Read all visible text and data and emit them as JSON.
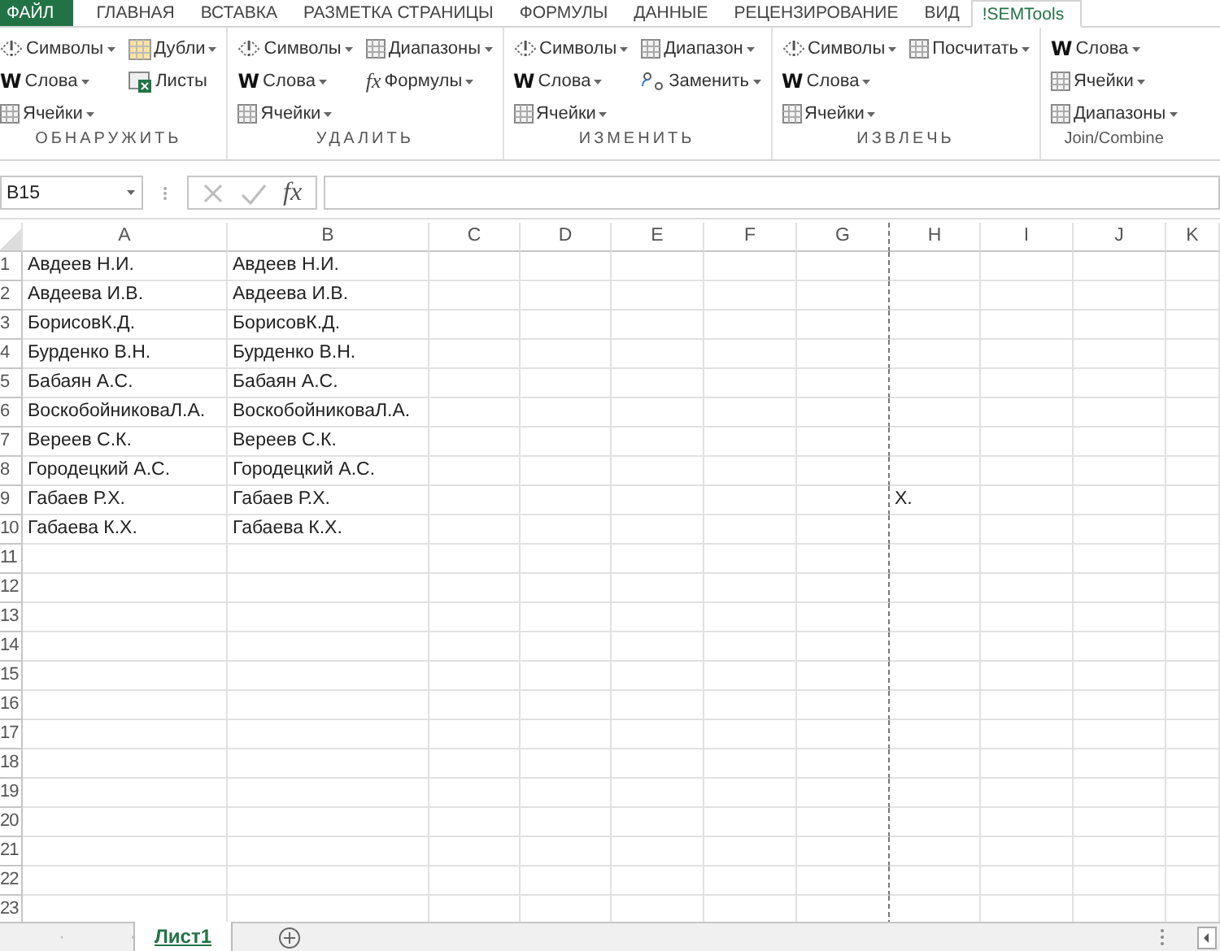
{
  "tabs": [
    {
      "label": "ФАЙЛ",
      "kind": "file",
      "selected": false
    },
    {
      "label": "ГЛАВНАЯ",
      "kind": "tab",
      "selected": false
    },
    {
      "label": "ВСТАВКА",
      "kind": "tab",
      "selected": false
    },
    {
      "label": "РАЗМЕТКА СТРАНИЦЫ",
      "kind": "tab",
      "selected": false
    },
    {
      "label": "ФОРМУЛЫ",
      "kind": "tab",
      "selected": false
    },
    {
      "label": "ДАННЫЕ",
      "kind": "tab",
      "selected": false
    },
    {
      "label": "РЕЦЕНЗИРОВАНИЕ",
      "kind": "tab",
      "selected": false
    },
    {
      "label": "ВИД",
      "kind": "tab",
      "selected": false
    },
    {
      "label": "!SEMTools",
      "kind": "tab",
      "selected": true
    }
  ],
  "ribbon": {
    "groups": [
      {
        "label": "ОБНАРУЖИТЬ",
        "spaced": true,
        "columns": [
          [
            {
              "kind": "symbols",
              "label": "Символы",
              "dropdown": true
            },
            {
              "kind": "words",
              "glyph": "W",
              "label": "Слова",
              "dropdown": true
            },
            {
              "kind": "grid",
              "label": "Ячейки",
              "dropdown": true
            }
          ],
          [
            {
              "kind": "dupes",
              "label": "Дубли",
              "dropdown": true
            },
            {
              "kind": "sheets",
              "label": "Листы",
              "dropdown": false
            }
          ]
        ]
      },
      {
        "label": "УДАЛИТЬ",
        "spaced": true,
        "columns": [
          [
            {
              "kind": "symbols",
              "label": "Символы",
              "dropdown": true
            },
            {
              "kind": "words",
              "glyph": "W",
              "label": "Слова",
              "dropdown": true
            },
            {
              "kind": "grid",
              "label": "Ячейки",
              "dropdown": true
            }
          ],
          [
            {
              "kind": "grid",
              "label": "Диапазоны",
              "dropdown": true
            },
            {
              "kind": "fx",
              "glyph": "fx",
              "label": "Формулы",
              "dropdown": true
            }
          ]
        ]
      },
      {
        "label": "ИЗМЕНИТЬ",
        "spaced": true,
        "columns": [
          [
            {
              "kind": "symbols",
              "label": "Символы",
              "dropdown": true
            },
            {
              "kind": "words",
              "glyph": "W",
              "label": "Слова",
              "dropdown": true
            },
            {
              "kind": "grid",
              "label": "Ячейки",
              "dropdown": true
            }
          ],
          [
            {
              "kind": "grid",
              "label": "Диапазон",
              "dropdown": true
            },
            {
              "kind": "replace",
              "label": "Заменить",
              "dropdown": true
            }
          ]
        ]
      },
      {
        "label": "ИЗВЛЕЧЬ",
        "spaced": true,
        "columns": [
          [
            {
              "kind": "symbols",
              "label": "Символы",
              "dropdown": true
            },
            {
              "kind": "words",
              "glyph": "W",
              "label": "Слова",
              "dropdown": true
            },
            {
              "kind": "grid",
              "label": "Ячейки",
              "dropdown": true
            }
          ],
          [
            {
              "kind": "grid",
              "label": "Посчитать",
              "dropdown": true
            }
          ]
        ]
      },
      {
        "label": "Join/Combine",
        "spaced": false,
        "columns": [
          [
            {
              "kind": "words",
              "glyph": "W",
              "label": "Слова",
              "dropdown": true
            },
            {
              "kind": "grid",
              "label": "Ячейки",
              "dropdown": true
            },
            {
              "kind": "grid",
              "label": "Диапазоны",
              "dropdown": true
            }
          ]
        ]
      }
    ]
  },
  "formula_bar": {
    "name_box": "B15",
    "fx": "fx"
  },
  "sheet": {
    "columns": [
      {
        "label": "A",
        "page_break_after": false
      },
      {
        "label": "B",
        "page_break_after": false
      },
      {
        "label": "C",
        "page_break_after": false
      },
      {
        "label": "D",
        "page_break_after": false
      },
      {
        "label": "E",
        "page_break_after": false
      },
      {
        "label": "F",
        "page_break_after": false
      },
      {
        "label": "G",
        "page_break_after": true
      },
      {
        "label": "H",
        "page_break_after": false
      },
      {
        "label": "I",
        "page_break_after": false
      },
      {
        "label": "J",
        "page_break_after": false
      },
      {
        "label": "K",
        "page_break_after": false
      }
    ],
    "rows": [
      {
        "header": "1",
        "cells": [
          "Авдеев Н.И.",
          "Авдеев Н.И."
        ]
      },
      {
        "header": "2",
        "cells": [
          "Авдеева И.В.",
          "Авдеева И.В."
        ]
      },
      {
        "header": "3",
        "cells": [
          "БорисовК.Д.",
          "БорисовК.Д."
        ]
      },
      {
        "header": "4",
        "cells": [
          "Бурденко В.Н.",
          "Бурденко В.Н."
        ]
      },
      {
        "header": "5",
        "cells": [
          "Бабаян А.С.",
          "Бабаян А.С."
        ]
      },
      {
        "header": "6",
        "cells": [
          "ВоскобойниковаЛ.А.",
          "ВоскобойниковаЛ.А."
        ]
      },
      {
        "header": "7",
        "cells": [
          "Вереев С.К.",
          "Вереев С.К."
        ]
      },
      {
        "header": "8",
        "cells": [
          "Городецкий А.С.",
          "Городецкий А.С."
        ]
      },
      {
        "header": "9",
        "cells": [
          "Габаев Р.Х.",
          "Габаев Р.Х.",
          null,
          null,
          null,
          null,
          null,
          "Х."
        ]
      },
      {
        "header": "10",
        "cells": [
          "Габаева К.Х.",
          "Габаева К.Х."
        ]
      },
      {
        "header": "11"
      },
      {
        "header": "12"
      },
      {
        "header": "13"
      },
      {
        "header": "14"
      },
      {
        "header": "15"
      },
      {
        "header": "16"
      },
      {
        "header": "17"
      },
      {
        "header": "18"
      },
      {
        "header": "19"
      },
      {
        "header": "20"
      },
      {
        "header": "21"
      },
      {
        "header": "22"
      },
      {
        "header": "23"
      }
    ]
  },
  "sheet_tabs": [
    {
      "label": "Лист1",
      "selected": true
    }
  ]
}
